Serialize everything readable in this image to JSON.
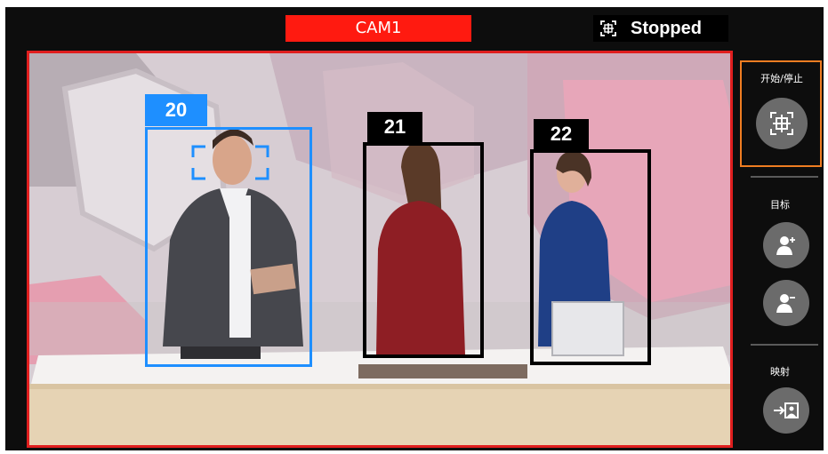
{
  "camera": {
    "label": "CAM1"
  },
  "status": {
    "text": "Stopped",
    "icon": "tracking-crosshair-icon"
  },
  "tracks": [
    {
      "id": "20",
      "selected": true
    },
    {
      "id": "21",
      "selected": false
    },
    {
      "id": "22",
      "selected": false
    }
  ],
  "panel": {
    "start_stop_label": "开始/停止",
    "target_label": "目标",
    "mapping_label": "映射"
  },
  "colors": {
    "camera_label_bg": "#ff1a10",
    "video_border": "#e01e1e",
    "selected_track": "#1e8fff",
    "active_control_border": "#ef7d22"
  }
}
